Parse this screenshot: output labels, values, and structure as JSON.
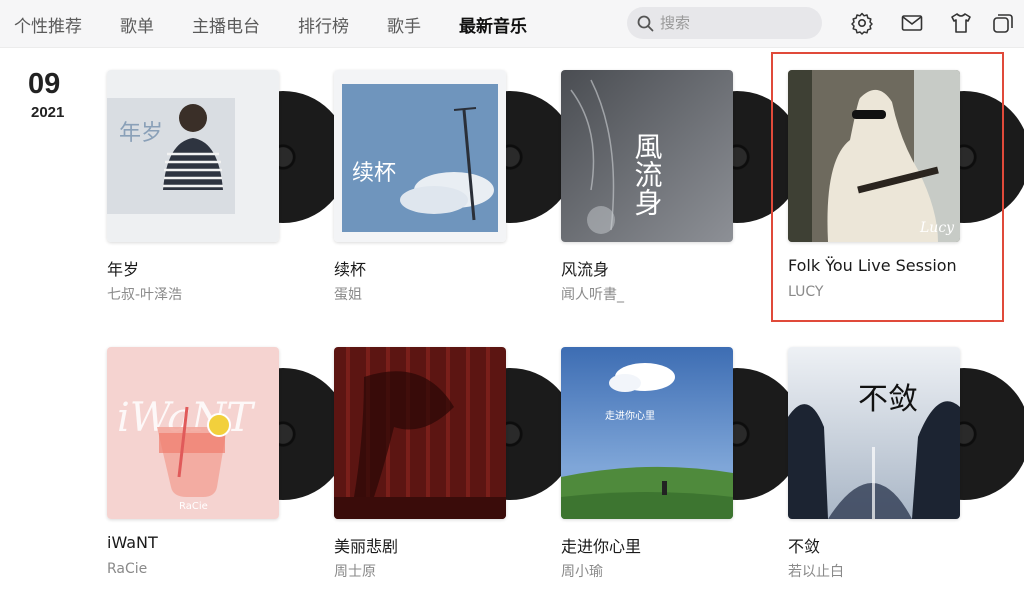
{
  "nav": {
    "tabs": [
      "个性推荐",
      "歌单",
      "主播电台",
      "排行榜",
      "歌手",
      "最新音乐"
    ],
    "active_index": 5,
    "search_placeholder": "搜索",
    "icons": [
      "settings-gear-icon",
      "mail-icon",
      "skin-tshirt-icon",
      "mini-mode-icon"
    ]
  },
  "date": {
    "day": "09",
    "year": "2021"
  },
  "albums": [
    {
      "title": "年岁",
      "artist": "七叔-叶泽浩"
    },
    {
      "title": "续杯",
      "artist": "蛋姐"
    },
    {
      "title": "风流身",
      "artist": "闻人听書_"
    },
    {
      "title": "Folk Ÿou Live Session",
      "artist": "LUCY"
    },
    {
      "title": "iWaNT",
      "artist": "RaCie"
    },
    {
      "title": "美丽悲剧",
      "artist": "周士原"
    },
    {
      "title": "走进你心里",
      "artist": "周小瑜"
    },
    {
      "title": "不敛",
      "artist": "若以止白"
    }
  ],
  "cover_text": {
    "c1": "年岁",
    "c2": "续杯",
    "c3": "風流身",
    "c4": "Lucy",
    "c5": "iWaNT",
    "c5_sub": "RaCie",
    "c7": "走进你心里",
    "c8": "不敛"
  },
  "colors": {
    "highlight": "#e04a3a",
    "active_tab": "#111111"
  }
}
